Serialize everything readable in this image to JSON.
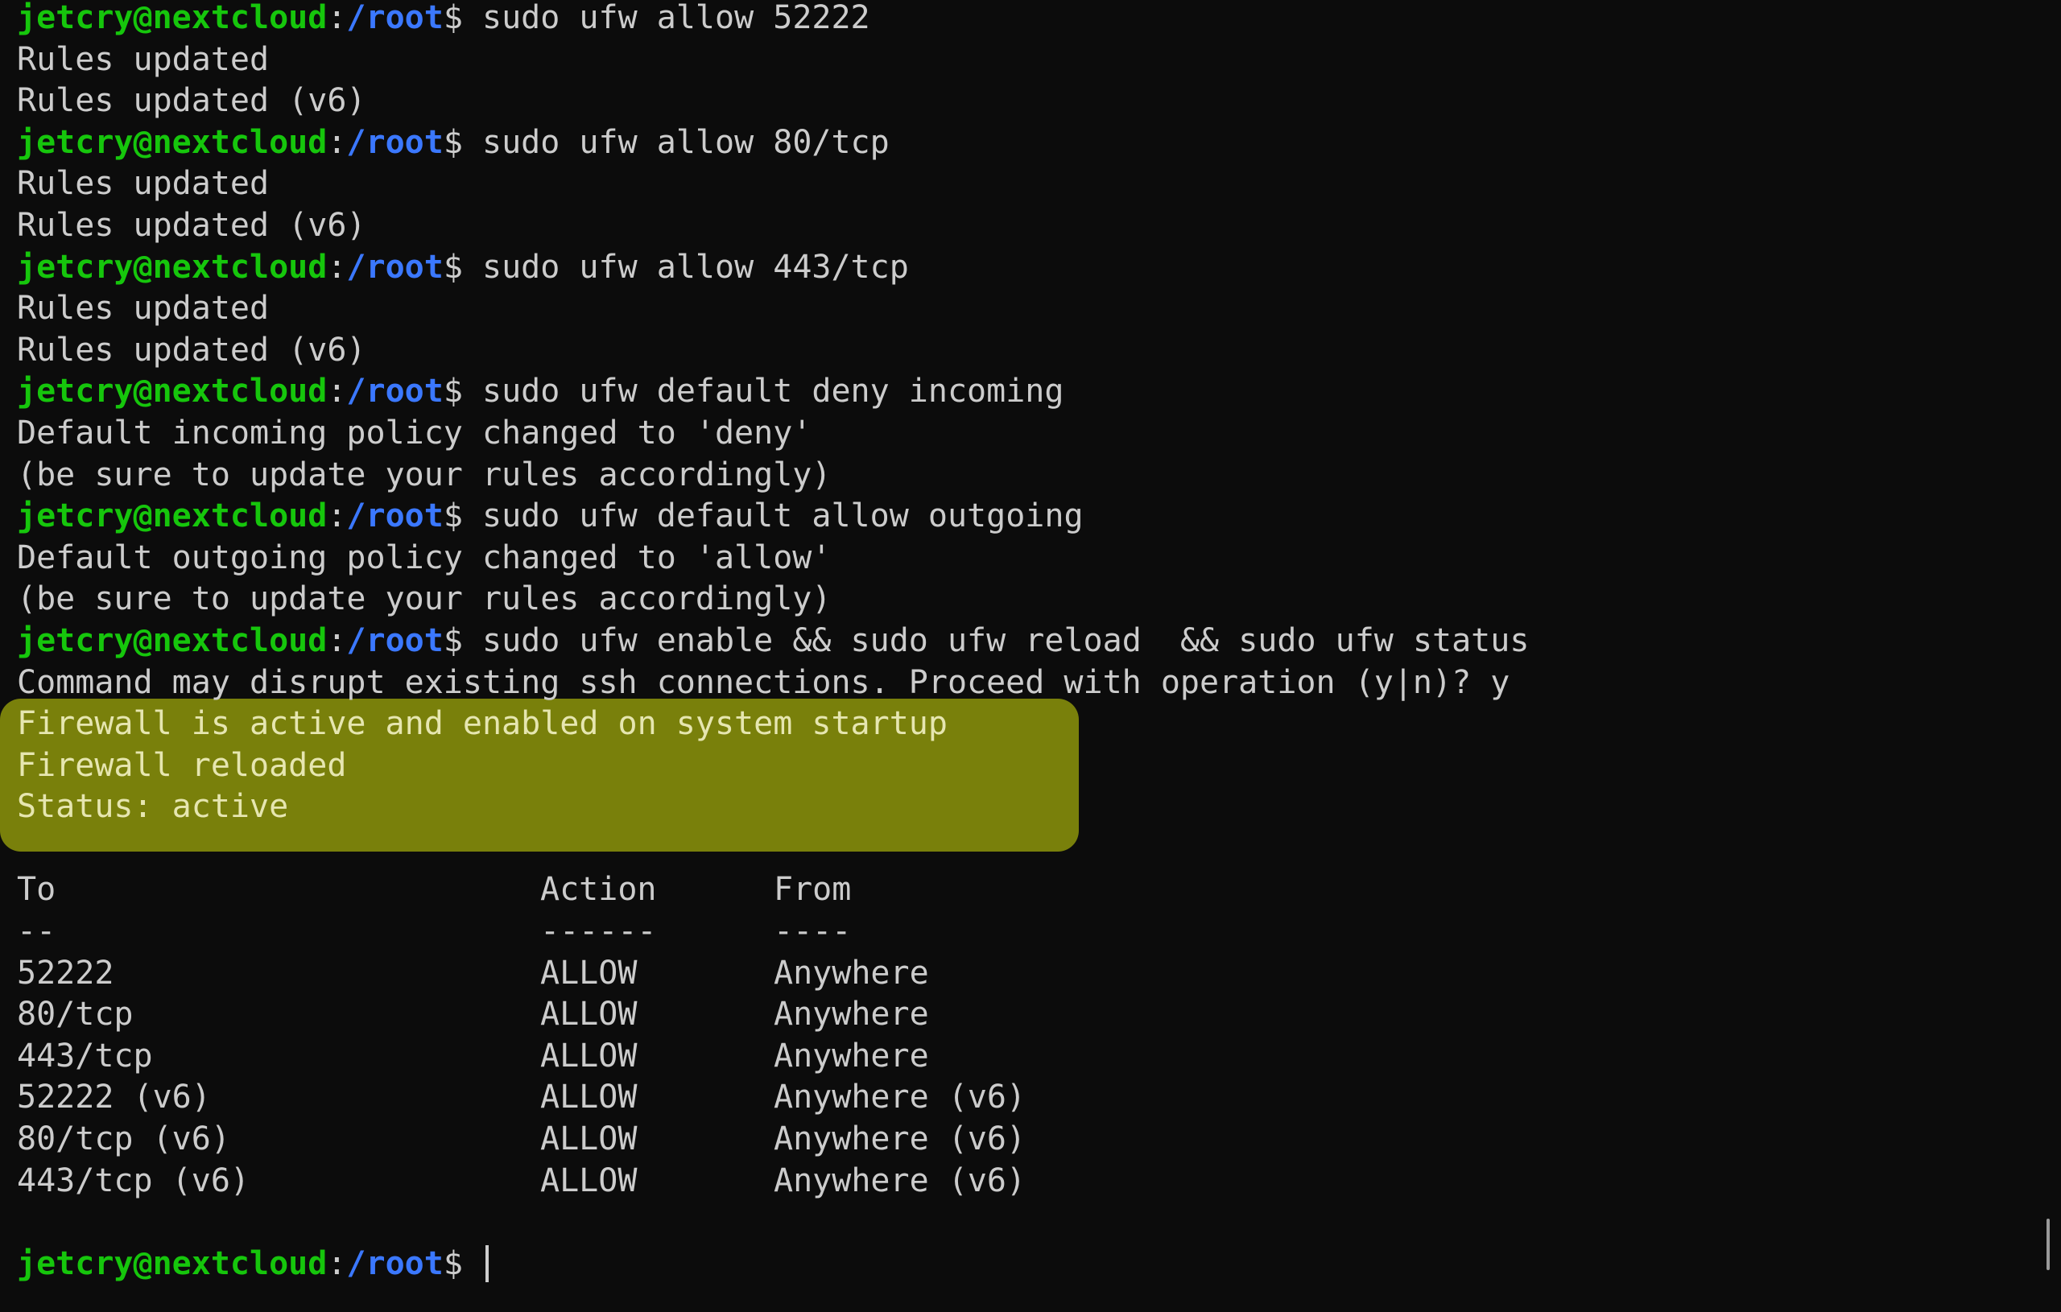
{
  "prompt": {
    "user_host": "jetcry@nextcloud",
    "colon": ":",
    "path": "/root",
    "dollar": "$ "
  },
  "blocks": [
    {
      "command": "sudo ufw allow 52222",
      "output": [
        "Rules updated",
        "Rules updated (v6)"
      ]
    },
    {
      "command": "sudo ufw allow 80/tcp",
      "output": [
        "Rules updated",
        "Rules updated (v6)"
      ]
    },
    {
      "command": "sudo ufw allow 443/tcp",
      "output": [
        "Rules updated",
        "Rules updated (v6)"
      ]
    },
    {
      "command": "sudo ufw default deny incoming",
      "output": [
        "Default incoming policy changed to 'deny'",
        "(be sure to update your rules accordingly)"
      ]
    },
    {
      "command": "sudo ufw default allow outgoing",
      "output": [
        "Default outgoing policy changed to 'allow'",
        "(be sure to update your rules accordingly)"
      ]
    },
    {
      "command": "sudo ufw enable && sudo ufw reload  && sudo ufw status",
      "output": [
        "Command may disrupt existing ssh connections. Proceed with operation (y|n)? y"
      ]
    }
  ],
  "highlighted_output": [
    "Firewall is active and enabled on system startup",
    "Firewall reloaded",
    "Status: active"
  ],
  "highlight_color": "#79800b",
  "rules_table": {
    "headers": [
      "To",
      "Action",
      "From"
    ],
    "separators": [
      "--",
      "------",
      "----"
    ],
    "rows": [
      [
        "52222",
        "ALLOW",
        "Anywhere"
      ],
      [
        "80/tcp",
        "ALLOW",
        "Anywhere"
      ],
      [
        "443/tcp",
        "ALLOW",
        "Anywhere"
      ],
      [
        "52222 (v6)",
        "ALLOW",
        "Anywhere (v6)"
      ],
      [
        "80/tcp (v6)",
        "ALLOW",
        "Anywhere (v6)"
      ],
      [
        "443/tcp (v6)",
        "ALLOW",
        "Anywhere (v6)"
      ]
    ]
  },
  "colors": {
    "background": "#0c0c0c",
    "text": "#cccccc",
    "user_host": "#16c60c",
    "path": "#3b78ff"
  }
}
